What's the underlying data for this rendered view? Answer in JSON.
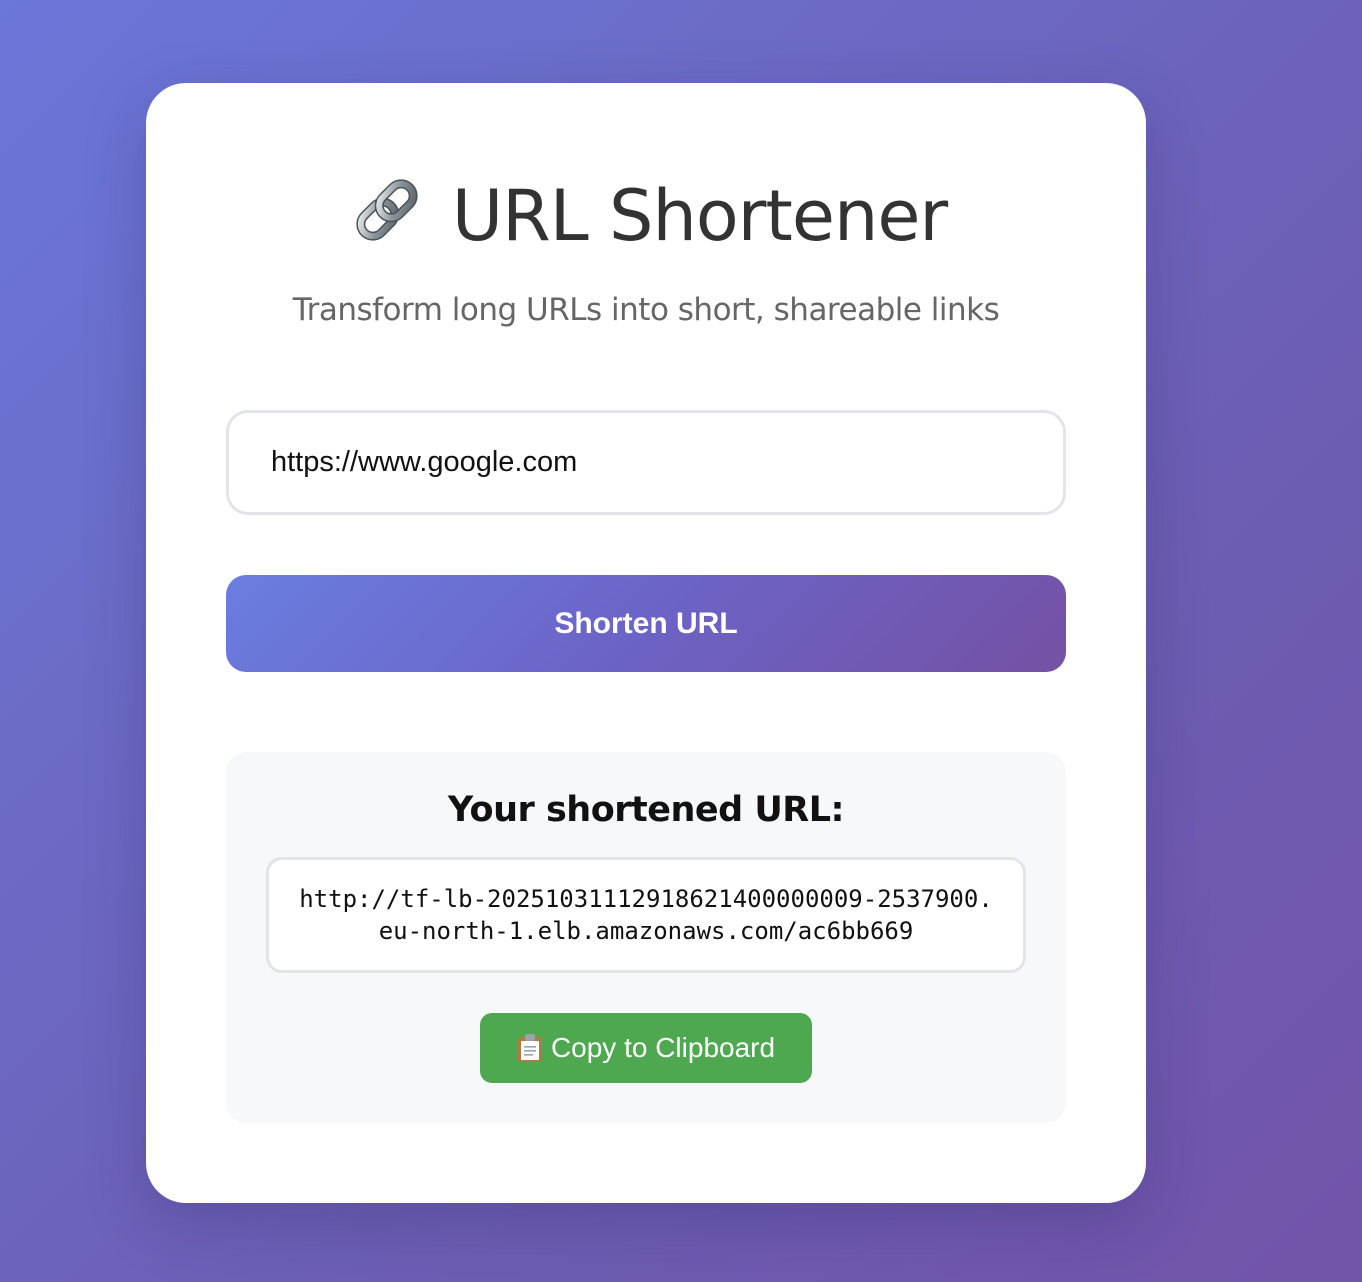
{
  "header": {
    "icon": "link-icon",
    "title": "URL Shortener",
    "subtitle": "Transform long URLs into short, shareable links"
  },
  "form": {
    "url_value": "https://www.google.com",
    "submit_label": "Shorten URL"
  },
  "result": {
    "heading": "Your shortened URL:",
    "short_url": "http://tf-lb-20251031112918621400000009-2537900.eu-north-1.elb.amazonaws.com/ac6bb669",
    "copy_icon": "clipboard-icon",
    "copy_label": "Copy to Clipboard"
  },
  "colors": {
    "background_gradient_start": "#6b77d9",
    "background_gradient_end": "#7254a8",
    "primary_button_start": "#6a7ee0",
    "primary_button_end": "#7451a3",
    "copy_button": "#4ea84f",
    "title_text": "#333333",
    "subtitle_text": "#666666"
  }
}
